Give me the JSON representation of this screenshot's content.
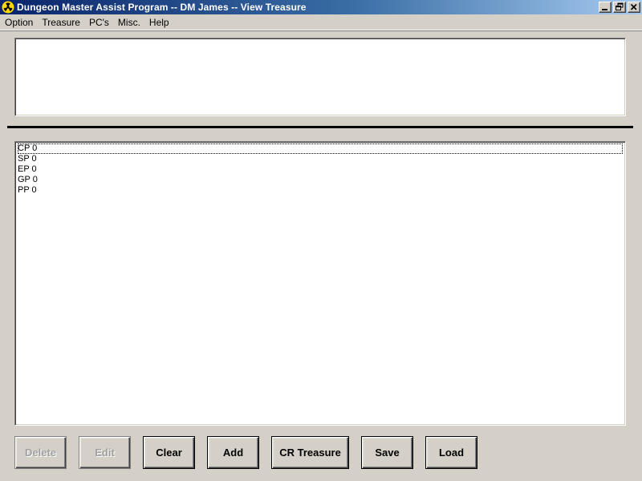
{
  "window": {
    "title": "Dungeon Master Assist Program -- DM James -- View Treasure",
    "app_icon": "radiation-icon",
    "title_bar_color": "#0a246a"
  },
  "menu": {
    "items": [
      {
        "label": "Option"
      },
      {
        "label": "Treasure"
      },
      {
        "label": "PC's"
      },
      {
        "label": "Misc."
      },
      {
        "label": "Help"
      }
    ]
  },
  "top_text": "",
  "treasure_list": {
    "items": [
      {
        "label": "CP 0",
        "focused": true
      },
      {
        "label": "SP 0"
      },
      {
        "label": "EP 0"
      },
      {
        "label": "GP 0"
      },
      {
        "label": "PP 0"
      }
    ]
  },
  "buttons": {
    "delete": {
      "label": "Delete",
      "enabled": false
    },
    "edit": {
      "label": "Edit",
      "enabled": false
    },
    "clear": {
      "label": "Clear",
      "enabled": true
    },
    "add": {
      "label": "Add",
      "enabled": true
    },
    "cr_treasure": {
      "label": "CR Treasure",
      "enabled": true
    },
    "save": {
      "label": "Save",
      "enabled": true
    },
    "load": {
      "label": "Load",
      "enabled": true
    }
  }
}
